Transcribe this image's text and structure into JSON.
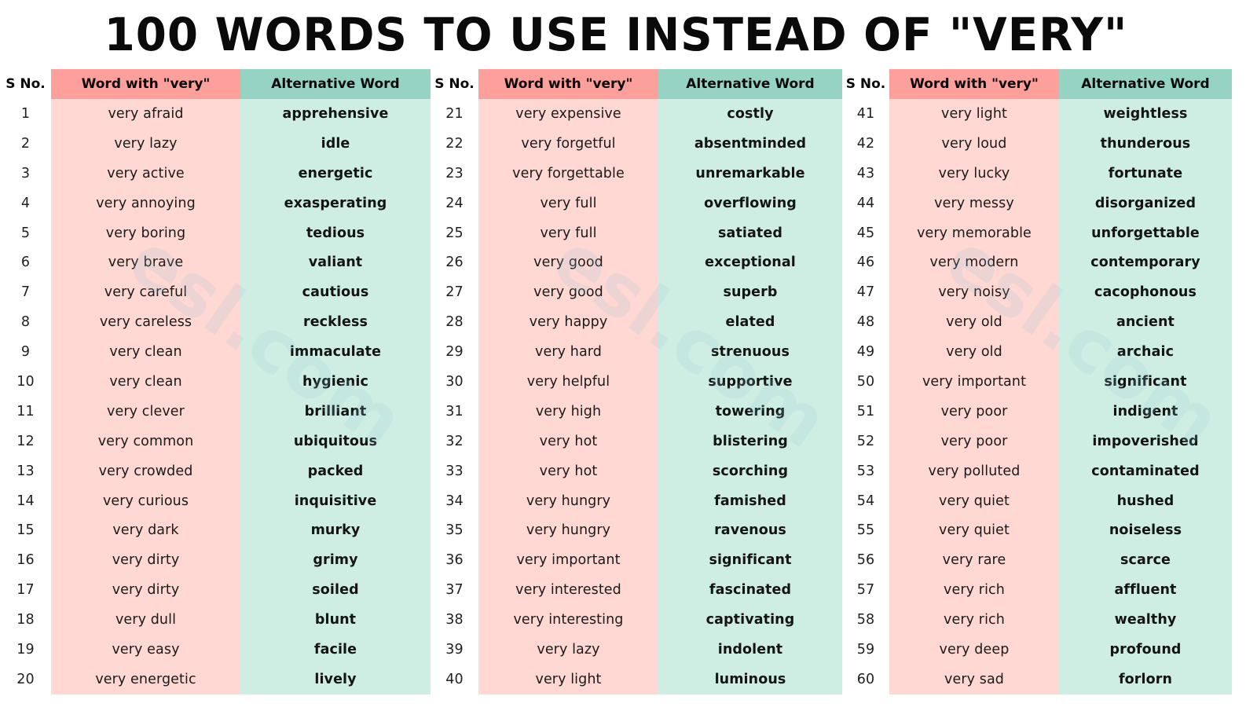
{
  "title": "100 WORDS TO USE INSTEAD OF \"VERY\"",
  "watermark": "esl.com",
  "colors": {
    "header_word_bg": "#fd9f9b",
    "header_alt_bg": "#97d3c2",
    "body_word_bg": "#ffd7d3",
    "body_alt_bg": "#cfeee3"
  },
  "headers": {
    "sno": "S No.",
    "word": "Word with \"very\"",
    "alt": "Alternative Word"
  },
  "panels": [
    {
      "rows": [
        {
          "sno": "1",
          "word": "very afraid",
          "alt": "apprehensive"
        },
        {
          "sno": "2",
          "word": "very lazy",
          "alt": "idle"
        },
        {
          "sno": "3",
          "word": "very active",
          "alt": "energetic"
        },
        {
          "sno": "4",
          "word": "very annoying",
          "alt": "exasperating"
        },
        {
          "sno": "5",
          "word": "very boring",
          "alt": "tedious"
        },
        {
          "sno": "6",
          "word": "very brave",
          "alt": "valiant"
        },
        {
          "sno": "7",
          "word": "very careful",
          "alt": "cautious"
        },
        {
          "sno": "8",
          "word": "very careless",
          "alt": "reckless"
        },
        {
          "sno": "9",
          "word": "very clean",
          "alt": "immaculate"
        },
        {
          "sno": "10",
          "word": "very clean",
          "alt": "hygienic"
        },
        {
          "sno": "11",
          "word": "very clever",
          "alt": "brilliant"
        },
        {
          "sno": "12",
          "word": "very common",
          "alt": "ubiquitous"
        },
        {
          "sno": "13",
          "word": "very crowded",
          "alt": "packed"
        },
        {
          "sno": "14",
          "word": "very curious",
          "alt": "inquisitive"
        },
        {
          "sno": "15",
          "word": "very dark",
          "alt": "murky"
        },
        {
          "sno": "16",
          "word": "very dirty",
          "alt": "grimy"
        },
        {
          "sno": "17",
          "word": "very dirty",
          "alt": "soiled"
        },
        {
          "sno": "18",
          "word": "very dull",
          "alt": "blunt"
        },
        {
          "sno": "19",
          "word": "very easy",
          "alt": "facile"
        },
        {
          "sno": "20",
          "word": "very energetic",
          "alt": "lively"
        }
      ]
    },
    {
      "rows": [
        {
          "sno": "21",
          "word": "very expensive",
          "alt": "costly"
        },
        {
          "sno": "22",
          "word": "very forgetful",
          "alt": "absentminded"
        },
        {
          "sno": "23",
          "word": "very forgettable",
          "alt": "unremarkable"
        },
        {
          "sno": "24",
          "word": "very full",
          "alt": "overflowing"
        },
        {
          "sno": "25",
          "word": "very full",
          "alt": "satiated"
        },
        {
          "sno": "26",
          "word": "very good",
          "alt": "exceptional"
        },
        {
          "sno": "27",
          "word": "very good",
          "alt": "superb"
        },
        {
          "sno": "28",
          "word": "very happy",
          "alt": "elated"
        },
        {
          "sno": "29",
          "word": "very hard",
          "alt": "strenuous"
        },
        {
          "sno": "30",
          "word": "very helpful",
          "alt": "supportive"
        },
        {
          "sno": "31",
          "word": "very high",
          "alt": "towering"
        },
        {
          "sno": "32",
          "word": "very hot",
          "alt": "blistering"
        },
        {
          "sno": "33",
          "word": "very hot",
          "alt": "scorching"
        },
        {
          "sno": "34",
          "word": "very hungry",
          "alt": "famished"
        },
        {
          "sno": "35",
          "word": "very hungry",
          "alt": "ravenous"
        },
        {
          "sno": "36",
          "word": "very important",
          "alt": "significant"
        },
        {
          "sno": "37",
          "word": "very interested",
          "alt": "fascinated"
        },
        {
          "sno": "38",
          "word": "very interesting",
          "alt": "captivating"
        },
        {
          "sno": "39",
          "word": "very lazy",
          "alt": "indolent"
        },
        {
          "sno": "40",
          "word": "very light",
          "alt": "luminous"
        }
      ]
    },
    {
      "rows": [
        {
          "sno": "41",
          "word": "very light",
          "alt": "weightless"
        },
        {
          "sno": "42",
          "word": "very loud",
          "alt": "thunderous"
        },
        {
          "sno": "43",
          "word": "very lucky",
          "alt": "fortunate"
        },
        {
          "sno": "44",
          "word": "very messy",
          "alt": "disorganized"
        },
        {
          "sno": "45",
          "word": "very memorable",
          "alt": "unforgettable"
        },
        {
          "sno": "46",
          "word": "very modern",
          "alt": "contemporary"
        },
        {
          "sno": "47",
          "word": "very noisy",
          "alt": "cacophonous"
        },
        {
          "sno": "48",
          "word": "very old",
          "alt": "ancient"
        },
        {
          "sno": "49",
          "word": "very old",
          "alt": "archaic"
        },
        {
          "sno": "50",
          "word": "very important",
          "alt": "significant"
        },
        {
          "sno": "51",
          "word": "very poor",
          "alt": "indigent"
        },
        {
          "sno": "52",
          "word": "very poor",
          "alt": "impoverished"
        },
        {
          "sno": "53",
          "word": "very polluted",
          "alt": "contaminated"
        },
        {
          "sno": "54",
          "word": "very quiet",
          "alt": "hushed"
        },
        {
          "sno": "55",
          "word": "very quiet",
          "alt": "noiseless"
        },
        {
          "sno": "56",
          "word": "very rare",
          "alt": "scarce"
        },
        {
          "sno": "57",
          "word": "very rich",
          "alt": "affluent"
        },
        {
          "sno": "58",
          "word": "very rich",
          "alt": "wealthy"
        },
        {
          "sno": "59",
          "word": "very deep",
          "alt": "profound"
        },
        {
          "sno": "60",
          "word": "very sad",
          "alt": "forlorn"
        }
      ]
    }
  ]
}
